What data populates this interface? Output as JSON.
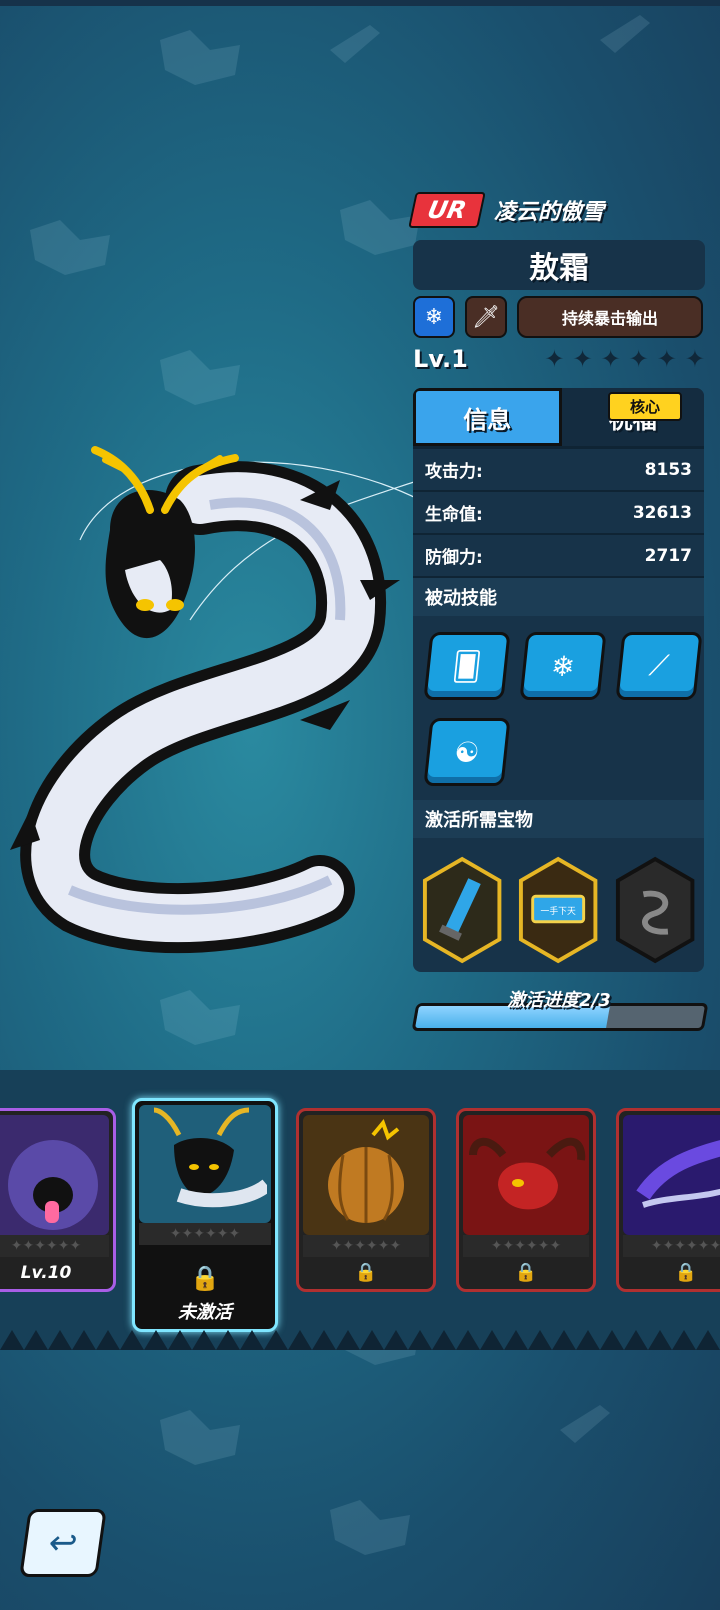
{
  "hero": {
    "rarity": "UR",
    "subtitle": "凌云的傲雪",
    "name": "敖霜",
    "element_icon": "snowflake-icon",
    "role_icon": "sword-icon",
    "trait": "持续暴击输出",
    "level": "Lv.1",
    "stars": 6
  },
  "tabs": {
    "info": "信息",
    "blessing": "祝福"
  },
  "stats": [
    {
      "label": "攻击力:",
      "value": "8153"
    },
    {
      "label": "生命值:",
      "value": "32613"
    },
    {
      "label": "防御力:",
      "value": "2717"
    }
  ],
  "sections": {
    "passive": "被动技能",
    "treasures": "激活所需宝物"
  },
  "skills": [
    "cards-dice-icon",
    "snowflakes-icon",
    "claw-slash-icon",
    "dragon-emblem-icon"
  ],
  "treasures": {
    "core_label": "核心",
    "items": [
      "blue-blade-treasure",
      "scroll-plaque-treasure",
      "dragon-core-treasure"
    ],
    "plaque_text": "一手下天"
  },
  "progress": {
    "label": "激活进度2/3",
    "value": 0.667
  },
  "carousel": {
    "cards": [
      {
        "id": "purple-beast",
        "level": "Lv.10"
      },
      {
        "id": "ice-dragon",
        "state": "未激活"
      },
      {
        "id": "pumpkin-beast"
      },
      {
        "id": "red-demon"
      },
      {
        "id": "violet-dragon"
      }
    ]
  },
  "colors": {
    "rarity": "#e8333c",
    "tab_active": "#3aa4ec",
    "panel": "#173349",
    "skill": "#1aa0e0",
    "core_badge": "#ffd21f",
    "progress": "#4ab0ea"
  }
}
